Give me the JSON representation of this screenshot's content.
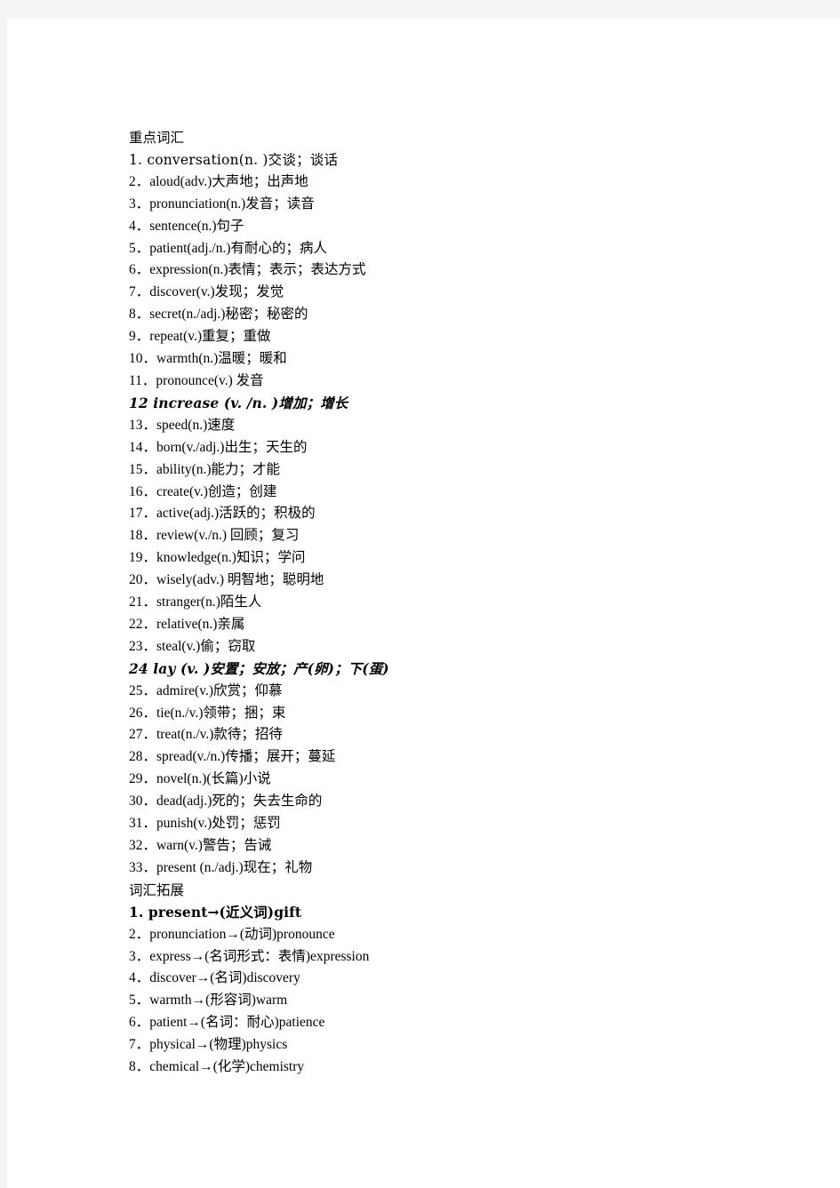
{
  "page": {
    "background_color": "#f4f4f4",
    "sheet_color": "#ffffff"
  },
  "sections": [
    {
      "heading": "重点词汇",
      "entries": [
        {
          "text": "1. conversation(n. )交谈；谈话",
          "style": "mono"
        },
        {
          "text": "2．aloud(adv.)大声地；出声地",
          "style": "normal"
        },
        {
          "text": "3．pronunciation(n.)发音；读音",
          "style": "normal"
        },
        {
          "text": "4．sentence(n.)句子",
          "style": "normal"
        },
        {
          "text": "5．patient(adj./n.)有耐心的；病人",
          "style": "normal"
        },
        {
          "text": "6．expression(n.)表情；表示；表达方式",
          "style": "normal"
        },
        {
          "text": "7．discover(v.)发现；发觉",
          "style": "normal"
        },
        {
          "text": "8．secret(n./adj.)秘密；秘密的",
          "style": "normal"
        },
        {
          "text": "9．repeat(v.)重复；重做",
          "style": "normal"
        },
        {
          "text": "10．warmth(n.)温暖；暖和",
          "style": "normal"
        },
        {
          "text": "11．pronounce(v.) 发音",
          "style": "normal"
        },
        {
          "text": "12 increase (v. /n. )增加；增长",
          "style": "emph"
        },
        {
          "text": "13．speed(n.)速度",
          "style": "normal"
        },
        {
          "text": "14．born(v./adj.)出生；天生的",
          "style": "normal"
        },
        {
          "text": "15．ability(n.)能力；才能",
          "style": "normal"
        },
        {
          "text": "16．create(v.)创造；创建",
          "style": "normal"
        },
        {
          "text": "17．active(adj.)活跃的；积极的",
          "style": "normal"
        },
        {
          "text": "18．review(v./n.) 回顾；复习",
          "style": "normal"
        },
        {
          "text": "19．knowledge(n.)知识；学问",
          "style": "normal"
        },
        {
          "text": "20．wisely(adv.) 明智地；聪明地",
          "style": "normal"
        },
        {
          "text": "21．stranger(n.)陌生人",
          "style": "normal"
        },
        {
          "text": "22．relative(n.)亲属",
          "style": "normal"
        },
        {
          "text": "23．steal(v.)偷；窃取",
          "style": "normal"
        },
        {
          "text": "24 lay (v. )安置；安放；产(卵)；下(蛋)",
          "style": "emph"
        },
        {
          "text": "25．admire(v.)欣赏；仰慕",
          "style": "normal"
        },
        {
          "text": "26．tie(n./v.)领带；捆；束",
          "style": "normal"
        },
        {
          "text": "27．treat(n./v.)款待；招待",
          "style": "normal"
        },
        {
          "text": "28．spread(v./n.)传播；展开；蔓延",
          "style": "normal"
        },
        {
          "text": "29．novel(n.)(长篇)小说",
          "style": "normal"
        },
        {
          "text": "30．dead(adj.)死的；失去生命的",
          "style": "normal"
        },
        {
          "text": "31．punish(v.)处罚；惩罚",
          "style": "normal"
        },
        {
          "text": "32．warn(v.)警告；告诫",
          "style": "normal"
        },
        {
          "text": "33．present (n./adj.)现在；礼物",
          "style": "normal"
        }
      ]
    },
    {
      "heading": "词汇拓展",
      "entries": [
        {
          "text": "1. present→(近义词)gift",
          "style": "strong"
        },
        {
          "text": "2．pronunciation→(动词)pronounce",
          "style": "normal"
        },
        {
          "text": "3．express→(名词形式：表情)expression",
          "style": "normal"
        },
        {
          "text": "4．discover→(名词)discovery",
          "style": "normal"
        },
        {
          "text": "5．warmth→(形容词)warm",
          "style": "normal"
        },
        {
          "text": "6．patient→(名词：耐心)patience",
          "style": "normal"
        },
        {
          "text": "7．physical→(物理)physics",
          "style": "normal"
        },
        {
          "text": "8．chemical→(化学)chemistry",
          "style": "normal"
        }
      ]
    }
  ]
}
